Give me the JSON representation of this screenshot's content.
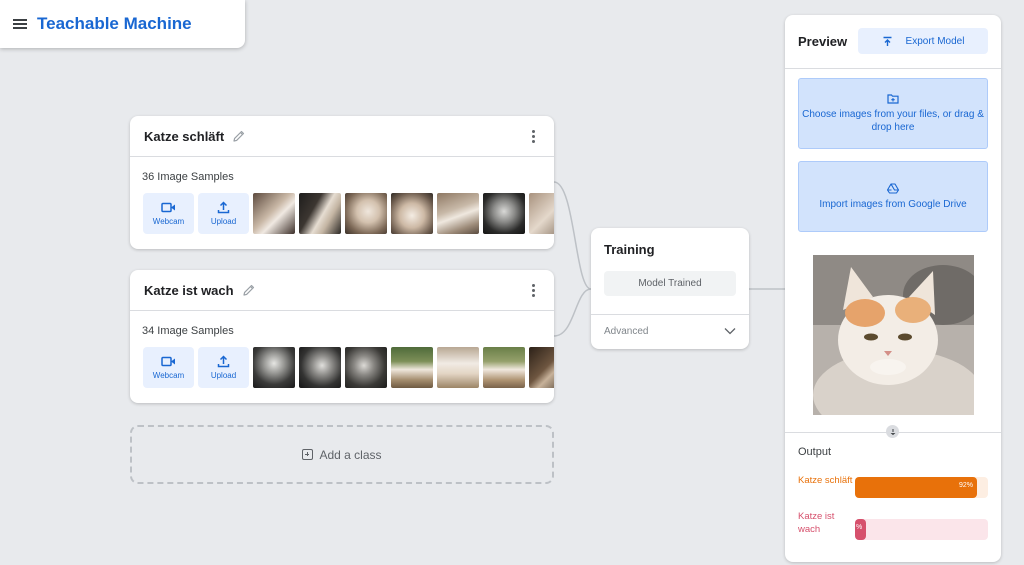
{
  "app": {
    "title": "Teachable Machine"
  },
  "classes": [
    {
      "name": "Katze schläft",
      "sample_count": "36 Image Samples",
      "webcam_label": "Webcam",
      "upload_label": "Upload"
    },
    {
      "name": "Katze ist wach",
      "sample_count": "34 Image Samples",
      "webcam_label": "Webcam",
      "upload_label": "Upload"
    }
  ],
  "add_class": {
    "label": "Add a class"
  },
  "training": {
    "title": "Training",
    "model_button": "Model Trained",
    "advanced_label": "Advanced"
  },
  "preview": {
    "title": "Preview",
    "export_button": "Export Model",
    "choose_files_text": "Choose images from your files, or drag & drop here",
    "drive_text": "Import images from Google Drive",
    "output_title": "Output",
    "outputs": [
      {
        "label": "Katze schläft",
        "value_text": "92%",
        "confidence": 0.92,
        "color": "#e8710a",
        "track_color": "#fdeee2"
      },
      {
        "label": "Katze ist wach",
        "value_text": "%",
        "confidence": 0.08,
        "color": "#d6506c",
        "track_color": "#fbe5ea"
      }
    ]
  },
  "colors": {
    "accent": "#1967d2",
    "background": "#e8eaed"
  }
}
